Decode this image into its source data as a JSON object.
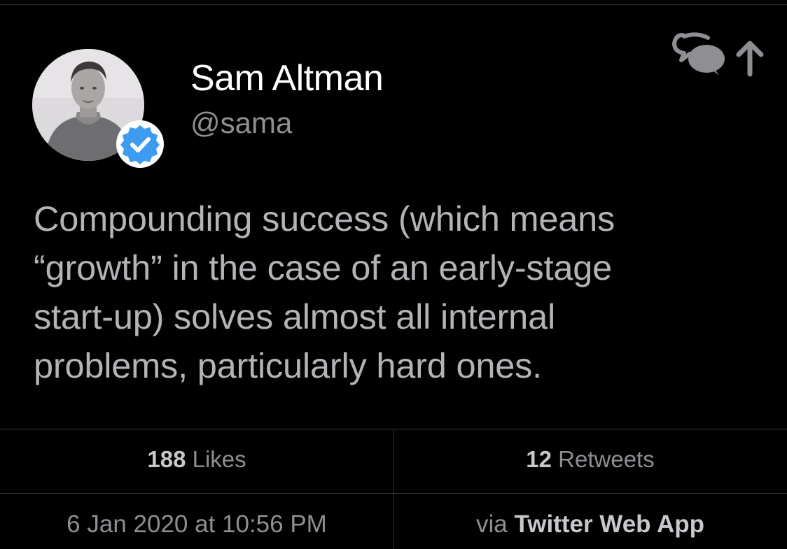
{
  "user": {
    "display_name": "Sam Altman",
    "handle": "@sama",
    "verified": true,
    "avatar_icon": "profile-photo-grayscale",
    "badge_icon": "verified-badge-icon"
  },
  "tweet": {
    "lines": [
      "Compounding success (which means",
      "“growth” in the case of an early-stage",
      "start-up) solves almost all internal",
      "problems, particularly hard ones."
    ]
  },
  "stats": {
    "likes_count": "188",
    "likes_label": "Likes",
    "retweets_count": "12",
    "retweets_label": "Retweets"
  },
  "meta": {
    "timestamp": "6 Jan 2020 at 10:56 PM",
    "via_prefix": "via",
    "source": "Twitter Web App"
  },
  "actions": {
    "share_icon": "share-upload-icon"
  },
  "colors": {
    "background": "#000000",
    "verified_blue": "#3d9cf0",
    "text_primary": "#ffffff",
    "text_secondary": "#8e8e93",
    "divider": "#333336"
  }
}
